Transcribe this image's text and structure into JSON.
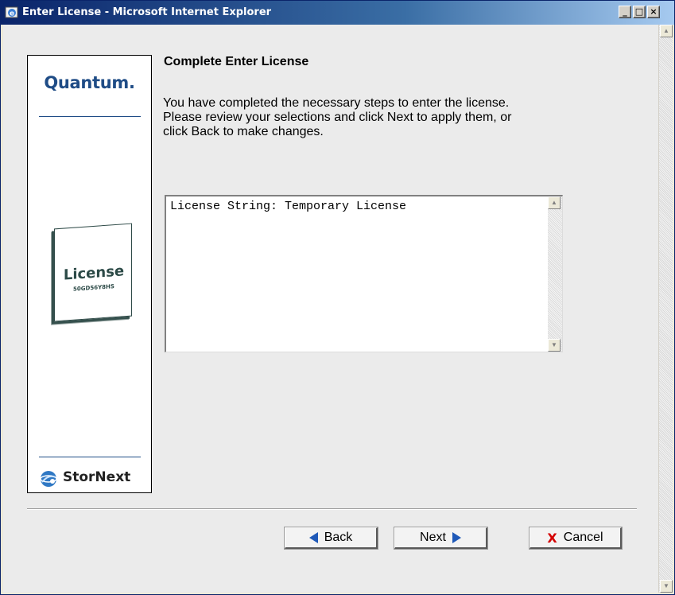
{
  "window": {
    "title": "Enter License - Microsoft Internet Explorer",
    "controls": {
      "minimize": "_",
      "maximize": "□",
      "close": "×"
    }
  },
  "sidebar": {
    "brand": "Quantum.",
    "license_card_title": "License",
    "license_card_code": "50GD56Y8HS",
    "product": "StorNext"
  },
  "content": {
    "heading": "Complete Enter License",
    "description_lines": [
      "You have completed the necessary steps to enter the license.",
      "Please review your selections and click Next to apply them, or",
      "click Back to make changes."
    ],
    "summary_text": "License String: Temporary License"
  },
  "buttons": {
    "back_label": "Back",
    "next_label": "Next",
    "cancel_label": "Cancel"
  },
  "colors": {
    "brand_blue": "#1f4c86",
    "arrow_blue": "#1f59b8",
    "cancel_red": "#d40000",
    "titlebar_start": "#0a246a",
    "titlebar_end": "#a6caf0"
  }
}
